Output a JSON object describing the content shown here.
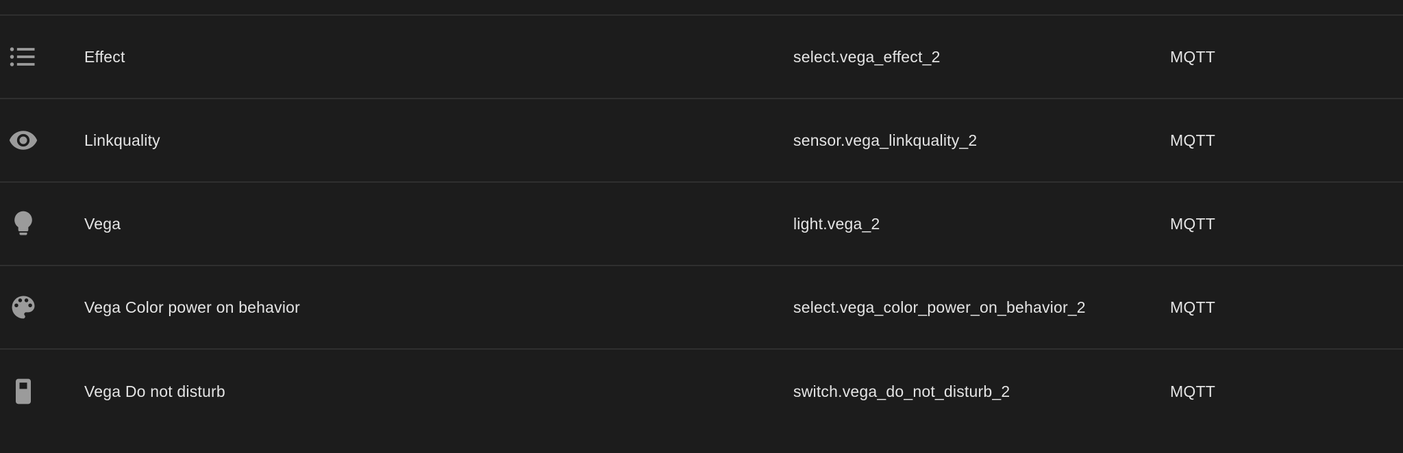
{
  "rows": [
    {
      "icon": "format-list-bulleted-icon",
      "name": "Effect",
      "entity_id": "select.vega_effect_2",
      "integration": "MQTT"
    },
    {
      "icon": "eye-icon",
      "name": "Linkquality",
      "entity_id": "sensor.vega_linkquality_2",
      "integration": "MQTT"
    },
    {
      "icon": "lightbulb-icon",
      "name": "Vega",
      "entity_id": "light.vega_2",
      "integration": "MQTT"
    },
    {
      "icon": "palette-icon",
      "name": "Vega Color power on behavior",
      "entity_id": "select.vega_color_power_on_behavior_2",
      "integration": "MQTT"
    },
    {
      "icon": "toggle-switch-icon",
      "name": "Vega Do not disturb",
      "entity_id": "switch.vega_do_not_disturb_2",
      "integration": "MQTT"
    }
  ],
  "colors": {
    "background": "#1c1c1c",
    "divider": "#2f2f2f",
    "text": "#e4e4e4",
    "icon": "#9b9b9b"
  }
}
